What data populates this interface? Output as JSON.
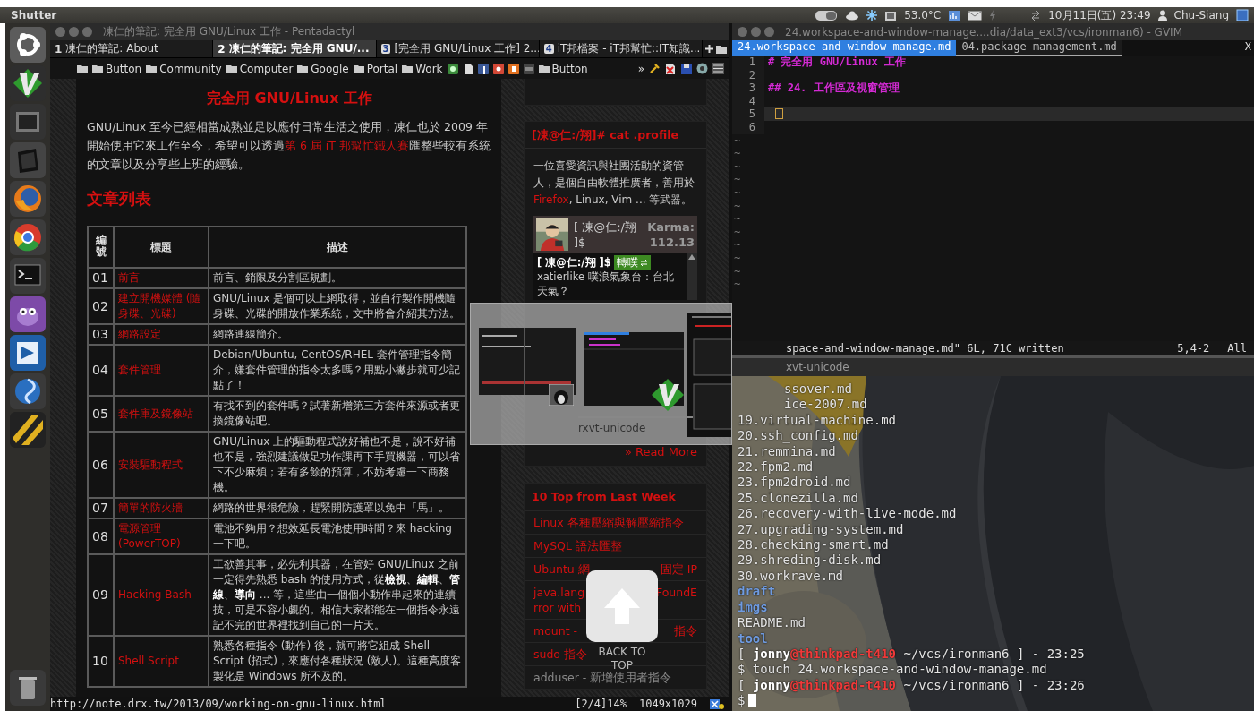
{
  "top_panel": {
    "title": "Shutter",
    "temperature": "53.0°C",
    "clock": "10月11日(五) 23:49",
    "user": "Chu-Siang"
  },
  "browser": {
    "title": "凍仁的筆記: 完全用 GNU/Linux 工作 - Pentadactyl",
    "tabs": [
      {
        "kind": "number",
        "number": "1",
        "label": "凍仁的筆記: About",
        "selected": false
      },
      {
        "kind": "number",
        "number": "2",
        "label": "凍仁的筆記: 完全用 GNU/...",
        "selected": true
      },
      {
        "kind": "icon",
        "number": "3",
        "label": "[完全用 GNU/Linux 工作] 2...",
        "selected": false
      },
      {
        "kind": "icon",
        "number": "4",
        "label": "iT邦檔案 - iT邦幫忙::IT知識...",
        "selected": false
      }
    ],
    "bookmarks": [
      {
        "kind": "folder"
      },
      {
        "kind": "folder",
        "label": "Button"
      },
      {
        "kind": "folder",
        "label": "Community"
      },
      {
        "kind": "folder",
        "label": "Computer"
      },
      {
        "kind": "folder",
        "label": "Google"
      },
      {
        "kind": "folder",
        "label": "Portal"
      },
      {
        "kind": "folder",
        "label": "Work"
      },
      {
        "kind": "site"
      },
      {
        "kind": "site"
      },
      {
        "kind": "site"
      },
      {
        "kind": "site"
      },
      {
        "kind": "site"
      },
      {
        "kind": "site"
      },
      {
        "kind": "folder",
        "label": "Button"
      }
    ],
    "overflow": "»",
    "article": {
      "title": "完全用 GNU/Linux 工作",
      "intro": {
        "before": "GNU/Linux 至今已經相當成熟並足以應付日常生活之使用，凍仁也於 2009 年開始使用它來工作至今，希望可以透過",
        "link": "第 6 屆 iT 邦幫忙鐵人賽",
        "after": "匯整些較有系統的文章以及分享些上班的經驗。"
      },
      "list_heading": "文章列表",
      "table": {
        "columns": [
          "編號",
          "標題",
          "描述"
        ],
        "rows": [
          {
            "number": "01",
            "title": "前言",
            "description": "前言、銷限及分割區規劃。"
          },
          {
            "number": "02",
            "title": "建立開機媒體 (隨身碟、光碟)",
            "description": "GNU/Linux 是個可以上網取得，並自行製作開機隨身碟、光碟的開放作業系統，文中將會介紹其方法。"
          },
          {
            "number": "03",
            "title": "網路設定",
            "description": "網路連線簡介。"
          },
          {
            "number": "04",
            "title": "套件管理",
            "description": "Debian/Ubuntu, CentOS/RHEL 套件管理指令簡介，嫌套件管理的指令太多嗎？用點小撇步就可少記點了！"
          },
          {
            "number": "05",
            "title": "套件庫及鏡像站",
            "description": "有找不到的套件嗎？試著新增第三方套件來源或者更換鏡像站吧。"
          },
          {
            "number": "06",
            "title": "安裝驅動程式",
            "description": "GNU/Linux 上的驅動程式說好補也不是，說不好補也不是，強烈建議做足功作課再下手買機器，可以省下不少麻煩；若有多餘的預算，不妨考慮一下商務機。"
          },
          {
            "number": "07",
            "title": "簡單的防火牆",
            "description": "網路的世界很危險，趕緊開防護罩以免中「馬」。"
          },
          {
            "number": "08",
            "title": "電源管理 (PowerTOP)",
            "description": "電池不夠用？想效延長電池使用時間？來 hacking 一下吧。"
          },
          {
            "number": "09",
            "title": "Hacking Bash",
            "description": "工欲善其事，必先利其器，在管好 GNU/Linux 之前一定得先熟悉 bash 的使用方式，從**檢視**、**編輯**、**管線**、**導向** ... 等，這些由一個個小動作串起來的連續技，可是不容小覷的。相信大家都能在一個指令永遠記不完的世界裡找到自己的一片天。"
          },
          {
            "number": "10",
            "title": "Shell Script",
            "description": "熟悉各種指令 (動作) 後，就可將它組成 Shell Script (招式)，來應付各種狀況 (敵人)。這種高度客製化是 Windows 所不及的。"
          }
        ]
      }
    },
    "sidebar": {
      "profile": {
        "heading": "[凍@仁:/翔]# cat .profile",
        "bio": {
          "before": "一位喜愛資訊與社團活動的資管人，是個自由軟體推廣者，善用於 ",
          "link": "Firefox",
          "after": ", Linux, Vim ... 等武器。"
        }
      },
      "plurk": {
        "name": "[ 凍@仁:/翔 ]$",
        "karma_label": "Karma:",
        "karma": "112.13",
        "post": {
          "author": "[ 凍@仁:/翔 ]$",
          "badge": "轉噗",
          "text": "xatierlike 噗浪氣象台：台北天氣？"
        }
      },
      "read_more": "» Read More",
      "top10": {
        "heading": "10 Top from Last Week",
        "items": [
          {
            "lines": [
              {
                "left": "Linux 各種壓縮與解壓縮指令"
              }
            ],
            "dimmed": false
          },
          {
            "lines": [
              {
                "left": "MySQL 語法匯整"
              }
            ],
            "dimmed": false
          },
          {
            "lines": [
              {
                "left": "Ubuntu 網",
                "right": "固定 IP"
              }
            ],
            "dimmed": false
          },
          {
            "lines": [
              {
                "left": "java.lang",
                "right": "FoundE"
              },
              {
                "left": "rror with"
              }
            ],
            "dimmed": false
          },
          {
            "lines": [
              {
                "left": "mount -",
                "right": "指令"
              }
            ],
            "dimmed": false
          },
          {
            "lines": [
              {
                "left": "sudo 指令"
              }
            ],
            "dimmed": false
          },
          {
            "lines": [
              {
                "left": "adduser - 新增使用者指令"
              }
            ],
            "dimmed": true
          }
        ]
      }
    },
    "back_to_top": {
      "label": "BACK TO TOP"
    },
    "status": {
      "url": "http://note.drx.tw/2013/09/working-on-gnu-linux.html",
      "position": "[2/4]14%",
      "size": "1049x1029"
    }
  },
  "gvim": {
    "title": "24.workspace-and-window-manage....dia/data_ext3/vcs/ironman6) - GVIM",
    "tabs": [
      {
        "label": "24.workspace-and-window-manage.md",
        "selected": true
      },
      {
        "label": "04.package-management.md",
        "selected": false
      }
    ],
    "close": "X",
    "lines": [
      {
        "number": "1",
        "text": "# 完全用 GNU/Linux 工作",
        "current": false
      },
      {
        "number": "2",
        "current": false
      },
      {
        "number": "3",
        "text": "## 24. 工作區及視窗管理",
        "current": false
      },
      {
        "number": "4",
        "current": false
      },
      {
        "number": "5",
        "current": true
      },
      {
        "number": "6",
        "current": false
      }
    ],
    "empty_lines": [
      "~",
      "~",
      "~",
      "~",
      "~",
      "~",
      "~",
      "~",
      "~",
      "~",
      "~",
      "~"
    ],
    "message": "space-and-window-manage.md\" 6L, 71C written",
    "ruler": "5,4-2",
    "scroll": "All"
  },
  "terminal": {
    "title": "xvt-unicode",
    "lines": [
      {
        "kind": "file",
        "text": "ssover.md",
        "cut": true
      },
      {
        "kind": "file",
        "text": "ice-2007.md",
        "cut": true
      },
      {
        "kind": "file",
        "text": "19.virtual-machine.md"
      },
      {
        "kind": "file",
        "text": "20.ssh_config.md"
      },
      {
        "kind": "file",
        "text": "21.remmina.md"
      },
      {
        "kind": "file",
        "text": "22.fpm2.md"
      },
      {
        "kind": "file",
        "text": "23.fpm2droid.md"
      },
      {
        "kind": "file",
        "text": "25.clonezilla.md"
      },
      {
        "kind": "file",
        "text": "26.recovery-with-live-mode.md"
      },
      {
        "kind": "file",
        "text": "27.upgrading-system.md"
      },
      {
        "kind": "file",
        "text": "28.checking-smart.md"
      },
      {
        "kind": "file",
        "text": "29.shreding-disk.md"
      },
      {
        "kind": "file",
        "text": "30.workrave.md"
      },
      {
        "kind": "dir",
        "text": "draft"
      },
      {
        "kind": "dir",
        "text": "imgs"
      },
      {
        "kind": "file",
        "text": "README.md"
      },
      {
        "kind": "dir",
        "text": "tool"
      },
      {
        "kind": "prompt",
        "open": "[",
        "user": "jonny",
        "host": "@thinkpad-t410",
        "path": "~/vcs/ironman6 ]",
        "time": "- 23:25"
      },
      {
        "kind": "command",
        "text": "$ touch 24.workspace-and-window-manage.md"
      },
      {
        "kind": "prompt",
        "open": "[",
        "user": "jonny",
        "host": "@thinkpad-t410",
        "path": "~/vcs/ironman6 ]",
        "time": "- 23:26"
      },
      {
        "kind": "input",
        "text": "$"
      }
    ]
  },
  "switcher": {
    "label": "rxvt-unicode"
  }
}
